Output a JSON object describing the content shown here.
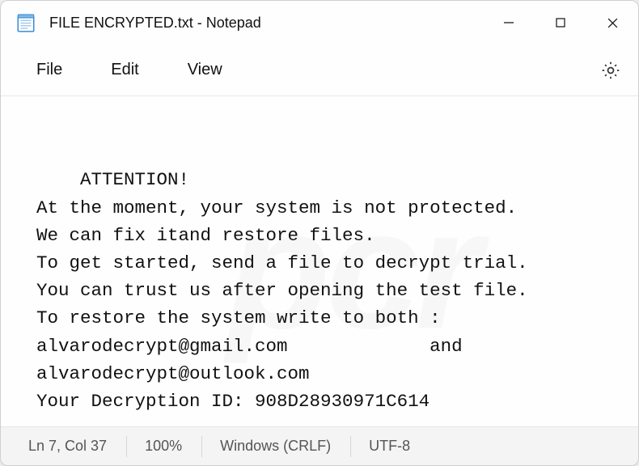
{
  "titlebar": {
    "title": "FILE ENCRYPTED.txt - Notepad"
  },
  "menu": {
    "file": "File",
    "edit": "Edit",
    "view": "View"
  },
  "body_text": "ATTENTION!\nAt the moment, your system is not protected.\nWe can fix itand restore files.\nTo get started, send a file to decrypt trial.\nYou can trust us after opening the test file.\nTo restore the system write to both :\nalvarodecrypt@gmail.com             and\nalvarodecrypt@outlook.com\nYour Decryption ID: 908D28930971C614",
  "status": {
    "position": "Ln 7, Col 37",
    "zoom": "100%",
    "eol": "Windows (CRLF)",
    "encoding": "UTF-8"
  }
}
